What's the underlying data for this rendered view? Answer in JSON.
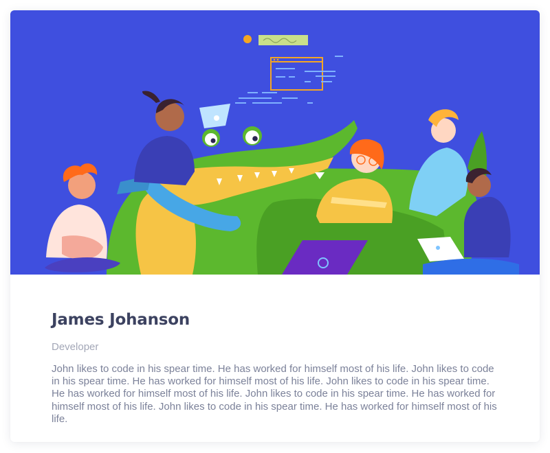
{
  "profile": {
    "name": "James Johanson",
    "role": "Developer",
    "bio": "John likes to code in his spear time. He has worked for himself most of his life. John likes to code in his spear time. He has worked for himself most of his life. John likes to code in his spear time. He has worked for himself most of his life. John likes to code in his spear time. He has worked for himself most of his life. John likes to code in his spear time. He has worked for himself most of his life."
  },
  "hero": {
    "illustration": "team-with-crocodile-illustration",
    "background_color": "#3f4fdf"
  },
  "colors": {
    "name_text": "#3c4260",
    "role_text": "#a3a7b7",
    "bio_text": "#7b8199",
    "crocodile": "#5cb82e",
    "accent_orange": "#f5a623"
  }
}
